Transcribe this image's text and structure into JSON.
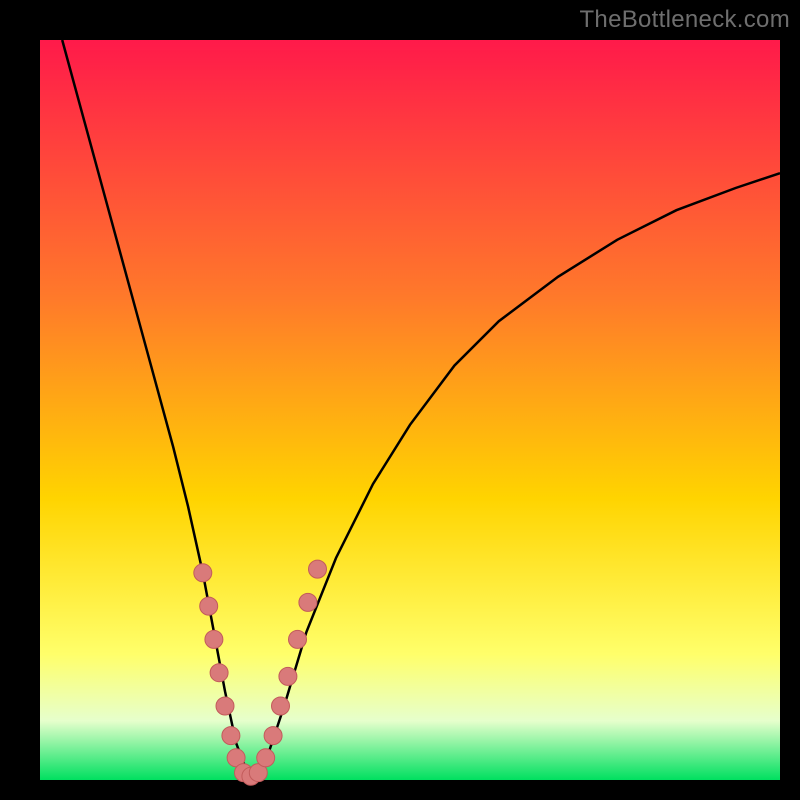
{
  "watermark": "TheBottleneck.com",
  "colors": {
    "gradient_top": "#ff1a4a",
    "gradient_mid1": "#ff7a2a",
    "gradient_mid2": "#ffd400",
    "gradient_mid3": "#ffff6a",
    "gradient_bottom_band": "#e6ffcc",
    "gradient_bottom": "#00e060",
    "curve": "#000000",
    "marker_fill": "#d97a7a",
    "marker_stroke": "#c25b5b",
    "background": "#000000"
  },
  "chart_data": {
    "type": "line",
    "title": "",
    "xlabel": "",
    "ylabel": "",
    "xlim": [
      0,
      100
    ],
    "ylim": [
      0,
      100
    ],
    "grid": false,
    "legend": false,
    "series": [
      {
        "name": "bottleneck-curve",
        "x": [
          3,
          6,
          9,
          12,
          15,
          18,
          20,
          22,
          23.5,
          25,
          26.5,
          28,
          29.5,
          31,
          33,
          36,
          40,
          45,
          50,
          56,
          62,
          70,
          78,
          86,
          94,
          100
        ],
        "y": [
          100,
          89,
          78,
          67,
          56,
          45,
          37,
          28,
          20,
          12,
          5,
          1,
          1,
          4,
          10,
          20,
          30,
          40,
          48,
          56,
          62,
          68,
          73,
          77,
          80,
          82
        ]
      }
    ],
    "markers": {
      "name": "highlight-dots",
      "x": [
        22.0,
        22.8,
        23.5,
        24.2,
        25.0,
        25.8,
        26.5,
        27.5,
        28.5,
        29.5,
        30.5,
        31.5,
        32.5,
        33.5,
        34.8,
        36.2,
        37.5
      ],
      "y": [
        28.0,
        23.5,
        19.0,
        14.5,
        10.0,
        6.0,
        3.0,
        1.0,
        0.5,
        1.0,
        3.0,
        6.0,
        10.0,
        14.0,
        19.0,
        24.0,
        28.5
      ]
    }
  }
}
